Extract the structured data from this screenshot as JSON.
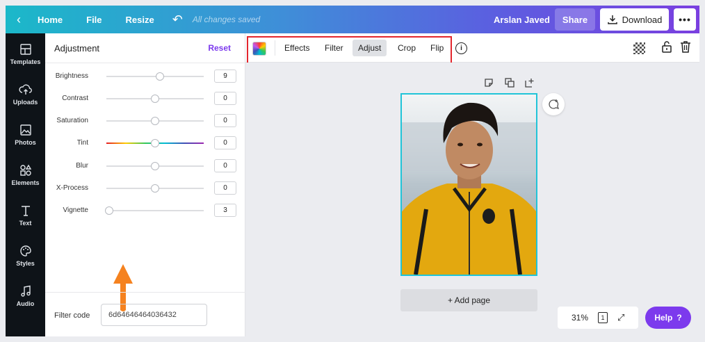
{
  "topbar": {
    "home": "Home",
    "file": "File",
    "resize": "Resize",
    "saved_status": "All changes saved",
    "user": "Arslan Javed",
    "share": "Share",
    "download": "Download",
    "more_icon": "ellipsis-icon"
  },
  "rail": {
    "items": [
      {
        "label": "Templates",
        "icon": "templates-icon"
      },
      {
        "label": "Uploads",
        "icon": "upload-cloud-icon"
      },
      {
        "label": "Photos",
        "icon": "photo-icon"
      },
      {
        "label": "Elements",
        "icon": "shapes-icon"
      },
      {
        "label": "Text",
        "icon": "text-icon"
      },
      {
        "label": "Styles",
        "icon": "palette-icon"
      },
      {
        "label": "Audio",
        "icon": "music-note-icon"
      }
    ]
  },
  "panel": {
    "title": "Adjustment",
    "reset": "Reset",
    "sliders": [
      {
        "label": "Brightness",
        "value": "9",
        "fraction": 0.55
      },
      {
        "label": "Contrast",
        "value": "0",
        "fraction": 0.5
      },
      {
        "label": "Saturation",
        "value": "0",
        "fraction": 0.5
      },
      {
        "label": "Tint",
        "value": "0",
        "fraction": 0.5
      },
      {
        "label": "Blur",
        "value": "0",
        "fraction": 0.5
      },
      {
        "label": "X-Process",
        "value": "0",
        "fraction": 0.5
      },
      {
        "label": "Vignette",
        "value": "3",
        "fraction": 0.03
      }
    ],
    "filter_code_label": "Filter code",
    "filter_code_value": "6d64646464036432"
  },
  "toolbar": {
    "effects": "Effects",
    "filter": "Filter",
    "adjust": "Adjust",
    "crop": "Crop",
    "flip": "Flip",
    "active": "Adjust"
  },
  "canvas": {
    "add_page": "+ Add page",
    "zoom": "31%",
    "page_number": "1"
  },
  "help": {
    "label": "Help",
    "mark": "?"
  },
  "colors": {
    "accent": "#7c3aed",
    "highlight_box": "#e3262d",
    "arrow": "#f5821f",
    "selection": "#20c4d8"
  }
}
